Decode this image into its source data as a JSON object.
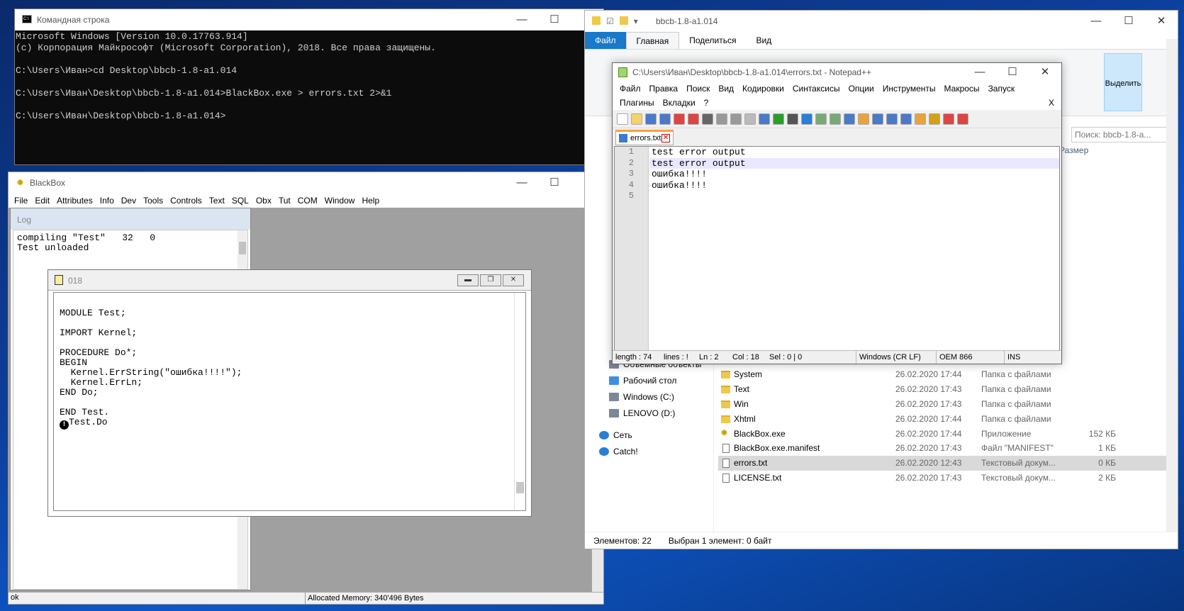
{
  "cmd": {
    "title": "Командная строка",
    "lines": [
      "Microsoft Windows [Version 10.0.17763.914]",
      "(c) Корпорация Майкрософт (Microsoft Corporation), 2018. Все права защищены.",
      "",
      "C:\\Users\\Иван>cd Desktop\\bbcb-1.8-a1.014",
      "",
      "C:\\Users\\Иван\\Desktop\\bbcb-1.8-a1.014>BlackBox.exe > errors.txt 2>&1",
      "",
      "C:\\Users\\Иван\\Desktop\\bbcb-1.8-a1.014>"
    ]
  },
  "blackbox": {
    "title": "BlackBox",
    "menu": [
      "File",
      "Edit",
      "Attributes",
      "Info",
      "Dev",
      "Tools",
      "Controls",
      "Text",
      "SQL",
      "Obx",
      "Tut",
      "COM",
      "Window",
      "Help"
    ],
    "log": {
      "title": "Log",
      "lines": [
        "compiling \"Test\"   32   0",
        "Test unloaded"
      ]
    },
    "module": {
      "title": "018",
      "code": "\nMODULE Test;\n\nIMPORT Kernel;\n\nPROCEDURE Do*;\nBEGIN\n  Kernel.ErrString(\"ошибка!!!!\");\n  Kernel.ErrLn;\nEND Do;\n\nEND Test.\n",
      "command": "Test.Do"
    },
    "status_left": "ok",
    "status_memory": "Allocated Memory: 340'496 Bytes"
  },
  "explorer": {
    "title": "bbcb-1.8-a1.014",
    "tabs": [
      "Файл",
      "Главная",
      "Поделиться",
      "Вид"
    ],
    "ribbon_select": "Выделить",
    "search_placeholder": "Поиск: bbcb-1.8-a...",
    "col_size": "Размер",
    "nav": [
      "Объемные объекты",
      "Рабочий стол",
      "Windows (C:)",
      "LENOVO (D:)",
      "Сеть",
      "Catch!"
    ],
    "files": [
      {
        "name": "System",
        "date": "26.02.2020 17:44",
        "type": "Папка с файлами",
        "size": "",
        "icon": "folder"
      },
      {
        "name": "Text",
        "date": "26.02.2020 17:43",
        "type": "Папка с файлами",
        "size": "",
        "icon": "folder"
      },
      {
        "name": "Win",
        "date": "26.02.2020 17:43",
        "type": "Папка с файлами",
        "size": "",
        "icon": "folder"
      },
      {
        "name": "Xhtml",
        "date": "26.02.2020 17:44",
        "type": "Папка с файлами",
        "size": "",
        "icon": "folder"
      },
      {
        "name": "BlackBox.exe",
        "date": "26.02.2020 17:44",
        "type": "Приложение",
        "size": "152 КБ",
        "icon": "gear"
      },
      {
        "name": "BlackBox.exe.manifest",
        "date": "26.02.2020 17:43",
        "type": "Файл \"MANIFEST\"",
        "size": "1 КБ",
        "icon": "doc"
      },
      {
        "name": "errors.txt",
        "date": "26.02.2020 12:43",
        "type": "Текстовый докум...",
        "size": "0 КБ",
        "icon": "doc"
      },
      {
        "name": "LICENSE.txt",
        "date": "26.02.2020 17:43",
        "type": "Текстовый докум...",
        "size": "2 КБ",
        "icon": "doc"
      }
    ],
    "status_count": "Элементов: 22",
    "status_selected": "Выбран 1 элемент: 0 байт"
  },
  "notepad": {
    "title": "C:\\Users\\Иван\\Desktop\\bbcb-1.8-a1.014\\errors.txt - Notepad++",
    "menu1": [
      "Файл",
      "Правка",
      "Поиск",
      "Вид",
      "Кодировки",
      "Синтаксисы",
      "Опции",
      "Инструменты",
      "Макросы",
      "Запуск"
    ],
    "menu2": [
      "Плагины",
      "Вкладки",
      "?"
    ],
    "menu_close": "X",
    "tab": "errors.txt",
    "lines": [
      "test error output",
      "test error output",
      "ошибка!!!!",
      "ошибка!!!!",
      ""
    ],
    "line_numbers": [
      "1",
      "2",
      "3",
      "4",
      "5"
    ],
    "status": {
      "length": "length : 74",
      "lines": "lines : !",
      "ln": "Ln : 2",
      "col": "Col : 18",
      "sel": "Sel : 0 | 0",
      "eol": "Windows (CR LF)",
      "enc": "OEM 866",
      "mode": "INS"
    }
  }
}
